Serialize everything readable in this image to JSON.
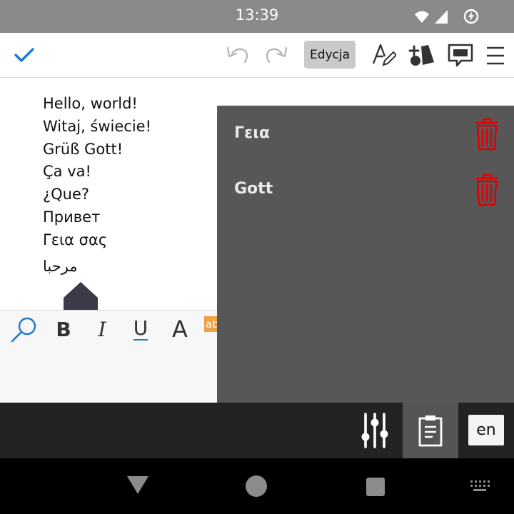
{
  "status_bar": {
    "time": "13:39",
    "icons": [
      "wifi-icon",
      "signal-icon",
      "battery-charging-icon"
    ]
  },
  "toolbar": {
    "confirm_icon": "check-icon",
    "undo_icon": "undo-icon",
    "redo_icon": "redo-icon",
    "edit_label": "Edycja",
    "font_style_icon": "font-style-icon",
    "shapes_icon": "insert-shapes-icon",
    "comment_icon": "comment-icon",
    "menu_icon": "hamburger-menu-icon",
    "accent_color": "#1b7ac9"
  },
  "document": {
    "lines": [
      "Hello, world!",
      "Witaj, świecie!",
      "Grüß Gott!",
      "Ça va!",
      "¿Que?",
      "Привет",
      "Γεια σας",
      "مرحبا"
    ]
  },
  "format_bar": {
    "bold_label": "B",
    "italic_label": "I",
    "underline_label": "U",
    "font_color_label": "A",
    "highlight_label": "ab",
    "highlight_color": "#f0a040"
  },
  "clipboard": {
    "items": [
      {
        "text": "Γεια"
      },
      {
        "text": "Gott"
      }
    ],
    "delete_icon": "trash-icon",
    "delete_color": "#e00000"
  },
  "keyboard_bar": {
    "settings_icon": "sliders-icon",
    "clipboard_icon": "clipboard-icon",
    "language": "en"
  },
  "nav_bar": {
    "back_icon": "back-triangle-icon",
    "home_icon": "home-circle-icon",
    "recents_icon": "recents-square-icon",
    "keyboard_icon": "keyboard-icon"
  }
}
